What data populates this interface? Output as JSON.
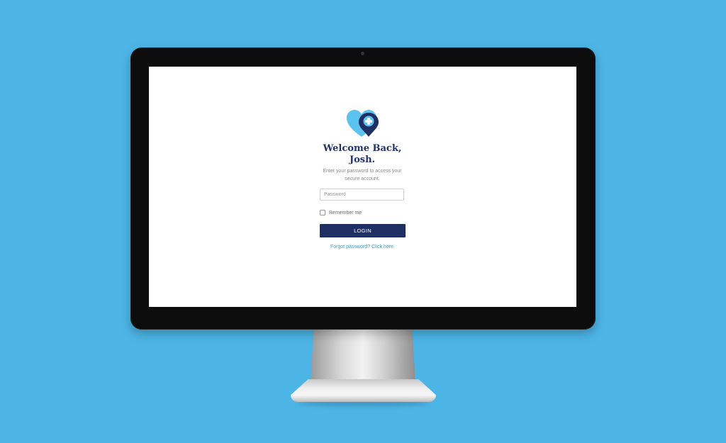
{
  "login": {
    "title_line1": "Welcome Back,",
    "title_line2": "Josh.",
    "subtitle_line1": "Enter your password to access your",
    "subtitle_line2": "secure account.",
    "password_placeholder": "Password",
    "password_value": "",
    "remember_label": "Remember me",
    "remember_checked": false,
    "login_button": "LOGIN",
    "forgot_link": "Forgot password? Click here."
  },
  "logo": {
    "icon": "heart-medical-pin-logo",
    "colors": {
      "heart": "#5cc2ee",
      "pin": "#1f2f63",
      "cross": "#ffffff"
    }
  },
  "colors": {
    "background": "#4db5e6",
    "accent": "#1f2f63",
    "link": "#2f9fd8"
  }
}
